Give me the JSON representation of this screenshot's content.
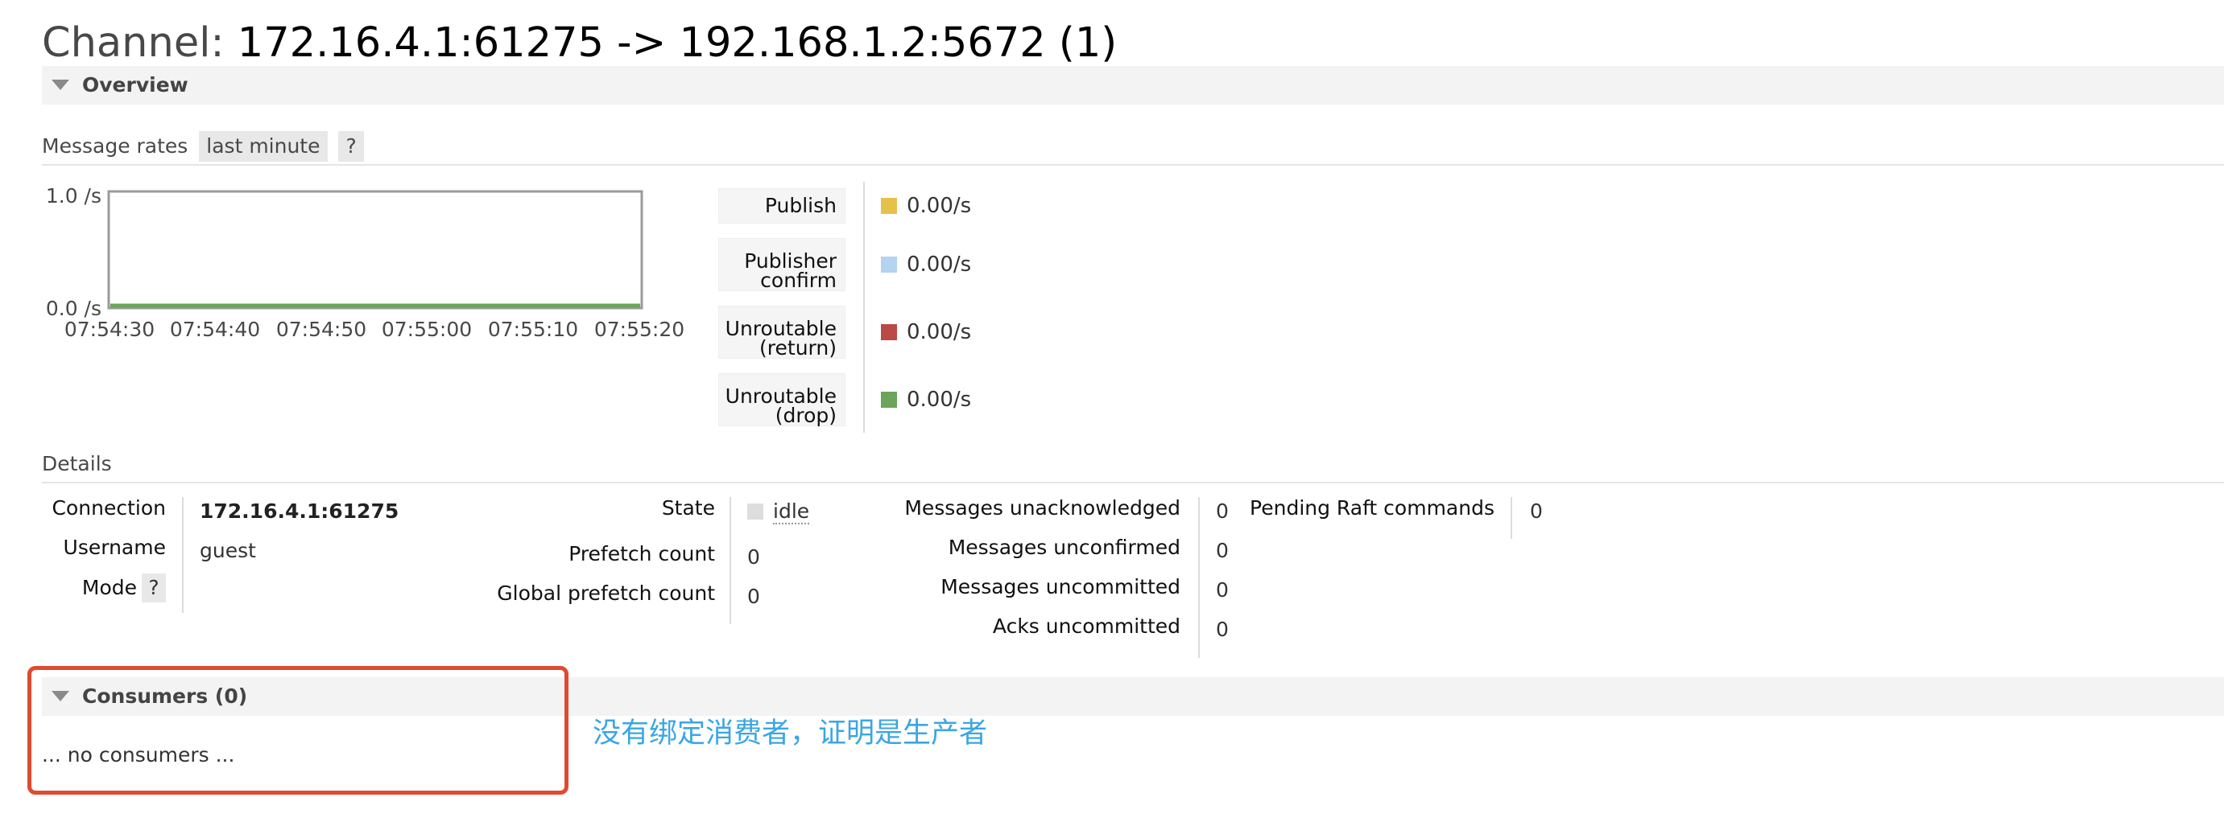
{
  "page": {
    "title_prefix": "Channel:",
    "title_name": "172.16.4.1:61275 -> 192.168.1.2:5672 (1)"
  },
  "overview": {
    "header": "Overview",
    "message_rates_label": "Message rates",
    "range_selector": "last minute",
    "help": "?"
  },
  "chart_data": {
    "type": "line",
    "x": [
      "07:54:30",
      "07:54:40",
      "07:54:50",
      "07:55:00",
      "07:55:10",
      "07:55:20"
    ],
    "y_tick_labels": [
      "1.0 /s",
      "0.0 /s"
    ],
    "ylim": [
      0,
      1
    ],
    "series": [
      {
        "name": "Publish",
        "color": "#e6c14a",
        "values": [
          0,
          0,
          0,
          0,
          0,
          0
        ]
      },
      {
        "name": "Publisher confirm",
        "color": "#b3d3ef",
        "values": [
          0,
          0,
          0,
          0,
          0,
          0
        ]
      },
      {
        "name": "Unroutable (return)",
        "color": "#b94a48",
        "values": [
          0,
          0,
          0,
          0,
          0,
          0
        ]
      },
      {
        "name": "Unroutable (drop)",
        "color": "#6aa55a",
        "values": [
          0,
          0,
          0,
          0,
          0,
          0
        ]
      }
    ],
    "legend_placement": "right"
  },
  "legend": [
    {
      "label_line1": "Publish",
      "label_line2": "",
      "value": "0.00/s",
      "color": "#e6c14a"
    },
    {
      "label_line1": "Publisher",
      "label_line2": "confirm",
      "value": "0.00/s",
      "color": "#b3d3ef"
    },
    {
      "label_line1": "Unroutable",
      "label_line2": "(return)",
      "value": "0.00/s",
      "color": "#b94a48"
    },
    {
      "label_line1": "Unroutable",
      "label_line2": "(drop)",
      "value": "0.00/s",
      "color": "#6aa55a"
    }
  ],
  "details": {
    "title": "Details",
    "connection_label": "Connection",
    "connection_value": "172.16.4.1:61275",
    "username_label": "Username",
    "username_value": "guest",
    "mode_label": "Mode",
    "mode_help": "?",
    "state_label": "State",
    "state_value": "idle",
    "prefetch_label": "Prefetch count",
    "prefetch_value": "0",
    "global_prefetch_label": "Global prefetch count",
    "global_prefetch_value": "0",
    "msgs_unacked_label": "Messages unacknowledged",
    "msgs_unacked_value": "0",
    "msgs_unconfirmed_label": "Messages unconfirmed",
    "msgs_unconfirmed_value": "0",
    "msgs_uncommitted_label": "Messages uncommitted",
    "msgs_uncommitted_value": "0",
    "acks_uncommitted_label": "Acks uncommitted",
    "acks_uncommitted_value": "0",
    "pending_raft_label": "Pending Raft commands",
    "pending_raft_value": "0"
  },
  "consumers": {
    "header": "Consumers (0)",
    "empty_text": "... no consumers ..."
  },
  "annotation": {
    "text": "没有绑定消费者，证明是生产者",
    "color": "#3aa6e4",
    "box_color": "#e04a2f"
  }
}
